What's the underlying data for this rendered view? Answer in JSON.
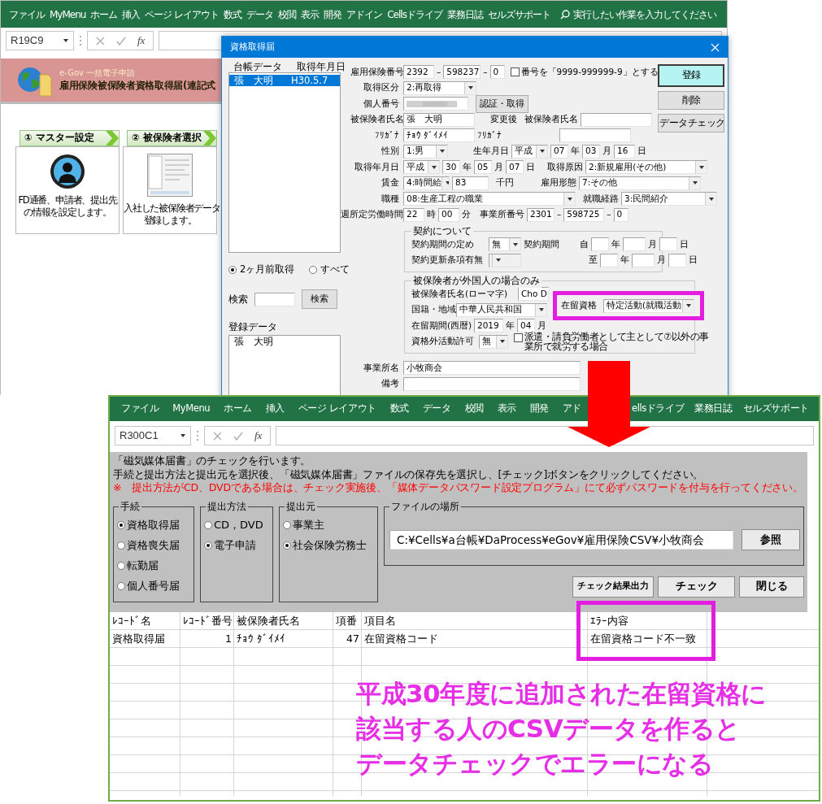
{
  "back_window": {
    "ribbon_tabs": [
      "ファイル",
      "MyMenu",
      "ホーム",
      "挿入",
      "ページ レイアウト",
      "数式",
      "データ",
      "校閲",
      "表示",
      "開発",
      "アドイン",
      "Cellsドライブ",
      "業務日誌",
      "セルズサポート"
    ],
    "tell_me": "実行したい作業を入力してください",
    "name_box": "R19C9",
    "function_label": "fx",
    "banner": {
      "subtitle": "e-Gov 一括電子申請",
      "title": "雇用保険被保険者資格取得届(連記式"
    },
    "steps": [
      {
        "label": "① マスター設定",
        "description_lines": [
          "FD通番、申請者、提出先",
          "の情報を設定します。"
        ]
      },
      {
        "label": "② 被保険者選択",
        "description_lines": [
          "入社した被保険者データ",
          "登録します。"
        ]
      }
    ]
  },
  "dialog": {
    "title": "資格取得届",
    "list_headers": [
      "台帳データ",
      "取得年月日"
    ],
    "list_rows": [
      {
        "name": "張　大明",
        "date": "H30.5.7",
        "selected": true
      }
    ],
    "range_options": [
      {
        "label": "2ヶ月前取得",
        "selected": true
      },
      {
        "label": "すべて",
        "selected": false
      }
    ],
    "search_label": "検索",
    "search_button": "検索",
    "registered_label": "登録データ",
    "registered_items": [
      "張　大明"
    ],
    "buttons": [
      {
        "label": "登録",
        "default": true
      },
      {
        "label": "削除",
        "default": false
      },
      {
        "label": "データチェック",
        "default": false
      }
    ],
    "form_rows": [
      {
        "items": [
          {
            "kind": "label",
            "text": "雇用保険番号"
          },
          {
            "kind": "input",
            "value": "2392"
          },
          {
            "kind": "text",
            "text": "–"
          },
          {
            "kind": "input",
            "value": "598237"
          },
          {
            "kind": "text",
            "text": "–"
          },
          {
            "kind": "input",
            "value": "0"
          },
          {
            "kind": "checkbox",
            "label": "番号を「9999-999999-9」とする",
            "checked": false
          }
        ]
      },
      {
        "items": [
          {
            "kind": "label",
            "text": "取得区分"
          },
          {
            "kind": "select",
            "value": "2:再取得"
          }
        ]
      },
      {
        "items": [
          {
            "kind": "label",
            "text": "個人番号"
          },
          {
            "kind": "masked"
          },
          {
            "kind": "button",
            "text": "認証・取得"
          }
        ]
      },
      {
        "items": [
          {
            "kind": "label",
            "text": "被保険者氏名"
          },
          {
            "kind": "input",
            "value": "張　大明"
          },
          {
            "kind": "text",
            "text": "変更後"
          },
          {
            "kind": "text",
            "text": "被保険者氏名"
          },
          {
            "kind": "input"
          }
        ]
      },
      {
        "items": [
          {
            "kind": "label",
            "text": "ﾌﾘｶﾞﾅ"
          },
          {
            "kind": "input",
            "value": "ﾁｮｳ ﾀﾞｲﾒｲ"
          },
          {
            "kind": "text",
            "text": "ﾌﾘｶﾞﾅ"
          },
          {
            "kind": "input"
          }
        ]
      },
      {
        "items": [
          {
            "kind": "label",
            "text": "性別"
          },
          {
            "kind": "select",
            "value": "1:男"
          },
          {
            "kind": "text",
            "text": "生年月日"
          },
          {
            "kind": "select",
            "value": "平成"
          },
          {
            "kind": "input",
            "value": "07"
          },
          {
            "kind": "text",
            "text": "年"
          },
          {
            "kind": "input",
            "value": "03"
          },
          {
            "kind": "text",
            "text": "月"
          },
          {
            "kind": "input",
            "value": "16"
          },
          {
            "kind": "text",
            "text": "日"
          }
        ]
      },
      {
        "items": [
          {
            "kind": "label",
            "text": "取得年月日"
          },
          {
            "kind": "select",
            "value": "平成"
          },
          {
            "kind": "input",
            "value": "30"
          },
          {
            "kind": "text",
            "text": "年"
          },
          {
            "kind": "input",
            "value": "05"
          },
          {
            "kind": "text",
            "text": "月"
          },
          {
            "kind": "input",
            "value": "07"
          },
          {
            "kind": "text",
            "text": "日"
          },
          {
            "kind": "text",
            "text": "取得原因"
          },
          {
            "kind": "select",
            "value": "2:新規雇用(その他)"
          }
        ]
      },
      {
        "items": [
          {
            "kind": "label",
            "text": "賃金"
          },
          {
            "kind": "select",
            "value": "4:時間給"
          },
          {
            "kind": "input",
            "value": "83"
          },
          {
            "kind": "text",
            "text": "千円"
          },
          {
            "kind": "text",
            "text": "雇用形態"
          },
          {
            "kind": "select",
            "value": "7:その他"
          }
        ]
      },
      {
        "items": [
          {
            "kind": "label",
            "text": "職種"
          },
          {
            "kind": "select",
            "value": "08:生産工程の職業"
          },
          {
            "kind": "text",
            "text": "就職経路"
          },
          {
            "kind": "select",
            "value": "3:民間紹介"
          }
        ]
      },
      {
        "items": [
          {
            "kind": "label",
            "text": "週所定労働時間"
          },
          {
            "kind": "input",
            "value": "22"
          },
          {
            "kind": "text",
            "text": "時"
          },
          {
            "kind": "input",
            "value": "00"
          },
          {
            "kind": "text",
            "text": "分"
          },
          {
            "kind": "text",
            "text": "事業所番号"
          },
          {
            "kind": "input",
            "value": "2301"
          },
          {
            "kind": "text",
            "text": "–"
          },
          {
            "kind": "input",
            "value": "598725"
          },
          {
            "kind": "text",
            "text": "–"
          },
          {
            "kind": "input",
            "value": "0"
          }
        ]
      }
    ],
    "groups": [
      {
        "title": "契約について",
        "rows": [
          {
            "items": [
              {
                "kind": "label",
                "text": "契約期間の定め"
              },
              {
                "kind": "select",
                "value": "無"
              },
              {
                "kind": "text",
                "text": "契約期間"
              },
              {
                "kind": "text",
                "text": "自"
              },
              {
                "kind": "input"
              },
              {
                "kind": "text",
                "text": "年"
              },
              {
                "kind": "input"
              },
              {
                "kind": "text",
                "text": "月"
              },
              {
                "kind": "input"
              },
              {
                "kind": "text",
                "text": "日"
              }
            ]
          },
          {
            "items": [
              {
                "kind": "label",
                "text": "契約更新条項有無"
              },
              {
                "kind": "select",
                "disabled": true
              },
              {
                "kind": "text",
                "text": "至"
              },
              {
                "kind": "input"
              },
              {
                "kind": "text",
                "text": "年"
              },
              {
                "kind": "input"
              },
              {
                "kind": "text",
                "text": "月"
              },
              {
                "kind": "input"
              },
              {
                "kind": "text",
                "text": "日"
              }
            ]
          }
        ]
      },
      {
        "title": "被保険者が外国人の場合のみ",
        "highlight": {
          "label": "在留資格",
          "value": "特定活動(就職活動"
        },
        "rows": [
          {
            "items": [
              {
                "kind": "label",
                "text": "被保険者氏名(ローマ字)"
              },
              {
                "kind": "input",
                "value": "Cho D"
              }
            ]
          },
          {
            "items": [
              {
                "kind": "label",
                "text": "国籍・地域"
              },
              {
                "kind": "select",
                "value": "中華人民共和国"
              }
            ]
          },
          {
            "items": [
              {
                "kind": "label",
                "text": "在留期間(西暦)"
              },
              {
                "kind": "input",
                "value": "2019"
              },
              {
                "kind": "text",
                "text": "年"
              },
              {
                "kind": "input",
                "value": "04"
              },
              {
                "kind": "text",
                "text": "月"
              }
            ]
          },
          {
            "items": [
              {
                "kind": "label",
                "text": "資格外活動許可"
              },
              {
                "kind": "select",
                "value": "無"
              },
              {
                "kind": "checkbox",
                "label": "派遣・請負労働者として主として⑦以外の事業所で就労する場合",
                "checked": false
              }
            ]
          }
        ]
      }
    ],
    "bottom_rows": [
      {
        "items": [
          {
            "kind": "label",
            "text": "事業所名"
          },
          {
            "kind": "input",
            "value": "小牧商会"
          }
        ]
      },
      {
        "items": [
          {
            "kind": "label",
            "text": "備考"
          },
          {
            "kind": "input"
          }
        ]
      }
    ]
  },
  "front_window": {
    "ribbon_tabs": [
      "ファイル",
      "MyMenu",
      "ホーム",
      "挿入",
      "ページ レイアウト",
      "数式",
      "データ",
      "校閲",
      "表示",
      "開発",
      "アド",
      "ellsドライブ",
      "業務日誌",
      "セルズサポート"
    ],
    "name_box": "R300C1",
    "function_label": "fx",
    "messages": [
      {
        "kind": "info",
        "text": "「磁気媒体届書」のチェックを行います。"
      },
      {
        "kind": "info",
        "text": "手続と提出方法と提出元を選択後、「磁気媒体届書」ファイルの保存先を選択し、[チェック]ボタンをクリックしてください。"
      },
      {
        "kind": "warning",
        "text": "※　提出方法がCD、DVDである場合は、チェック実施後、「媒体データパスワード設定プログラム」にて必ずパスワードを付与を行ってください。"
      }
    ],
    "option_groups": [
      {
        "title": "手続",
        "options": [
          {
            "label": "資格取得届",
            "selected": true
          },
          {
            "label": "資格喪失届",
            "selected": false
          },
          {
            "label": "転勤届",
            "selected": false
          },
          {
            "label": "個人番号届",
            "selected": false
          }
        ]
      },
      {
        "title": "提出方法",
        "options": [
          {
            "label": "CD，DVD",
            "selected": false
          },
          {
            "label": "電子申請",
            "selected": true
          }
        ]
      },
      {
        "title": "提出元",
        "options": [
          {
            "label": "事業主",
            "selected": false
          },
          {
            "label": "社会保険労務士",
            "selected": true
          }
        ]
      }
    ],
    "file_location": {
      "title": "ファイルの場所",
      "path": "C:¥Cells¥a台帳¥DaProcess¥eGov¥雇用保険CSV¥小牧商会",
      "button": "参照"
    },
    "buttons": [
      "チェック結果出力",
      "チェック",
      "閉じる"
    ],
    "table": {
      "columns": [
        {
          "label": "ﾚｺｰﾄﾞ名",
          "highlighted": false
        },
        {
          "label": "ﾚｺｰﾄﾞ番号",
          "highlighted": false
        },
        {
          "label": "被保険者氏名",
          "highlighted": false
        },
        {
          "label": "項番",
          "highlighted": false
        },
        {
          "label": "項目名",
          "highlighted": false
        },
        {
          "label": "ｴﾗｰ内容",
          "highlighted": true
        }
      ],
      "rows": [
        [
          "資格取得届",
          "1",
          "ﾁｮｳ ﾀﾞｲﾒｲ",
          "47",
          "在留資格コード",
          "在留資格コード不一致"
        ]
      ]
    }
  },
  "annotation": {
    "lines": [
      "平成30年度に追加された在留資格に",
      "該当する人のCSVデータを作ると",
      "データチェックでエラーになる"
    ]
  }
}
